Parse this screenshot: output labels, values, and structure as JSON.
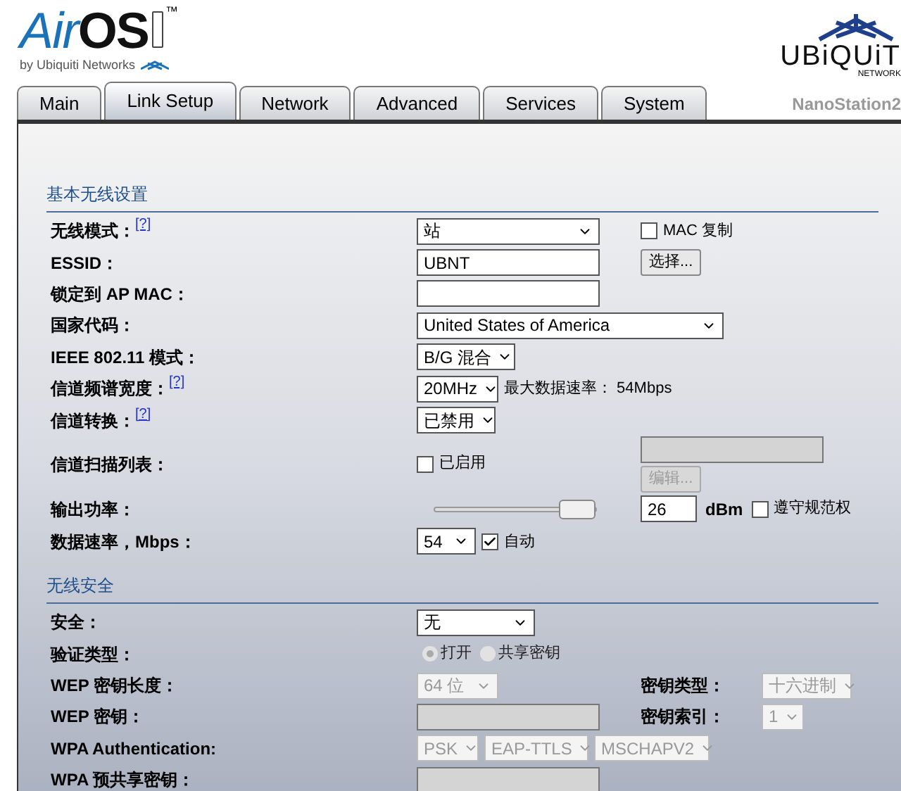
{
  "header": {
    "logo": {
      "air": "Air",
      "os": "OS",
      "tm": "™",
      "byline": "by Ubiquiti Networks"
    },
    "brand": {
      "name": "UBiQUiT",
      "sub": "NETWORK"
    },
    "device": "NanoStation2"
  },
  "tabs": [
    {
      "label": "Main",
      "selected": false
    },
    {
      "label": "Link Setup",
      "selected": true
    },
    {
      "label": "Network",
      "selected": false
    },
    {
      "label": "Advanced",
      "selected": false
    },
    {
      "label": "Services",
      "selected": false
    },
    {
      "label": "System",
      "selected": false
    }
  ],
  "sections": [
    {
      "title": "基本无线设置",
      "rows": [
        {
          "label": "无线模式：",
          "help": "[?]",
          "controls": [
            {
              "kind": "select",
              "value": "站",
              "disabled": false
            }
          ],
          "side": {
            "controls": [
              {
                "kind": "checkbox",
                "label": "MAC 复制",
                "checked": false,
                "disabled": false
              }
            ]
          }
        },
        {
          "label": "ESSID：",
          "controls": [
            {
              "kind": "text",
              "value": "UBNT",
              "disabled": false
            }
          ],
          "side": {
            "controls": [
              {
                "kind": "button",
                "label": "选择...",
                "disabled": false
              }
            ]
          }
        },
        {
          "label": "锁定到 AP MAC：",
          "controls": [
            {
              "kind": "text",
              "disabled": false
            }
          ]
        },
        {
          "label": "国家代码：",
          "controls": [
            {
              "kind": "select",
              "value": "United States of America",
              "disabled": false
            }
          ]
        },
        {
          "label": "IEEE 802.11 模式：",
          "controls": [
            {
              "kind": "select",
              "value": "B/G 混合",
              "disabled": false
            }
          ]
        },
        {
          "label": "信道频谱宽度：",
          "help": "[?]",
          "controls": [
            {
              "kind": "select",
              "value": "20MHz",
              "disabled": false
            },
            {
              "kind": "note",
              "text": "最大数据速率： 54Mbps"
            }
          ]
        },
        {
          "label": "信道转换：",
          "help": "[?]",
          "controls": [
            {
              "kind": "select",
              "value": "已禁用",
              "disabled": false
            }
          ]
        },
        {
          "label": "信道扫描列表：",
          "controls": [
            {
              "kind": "checkbox",
              "label": "已启用",
              "checked": false,
              "disabled": false
            }
          ],
          "side": {
            "controls": [
              {
                "kind": "stack",
                "items": [
                  {
                    "kind": "text",
                    "disabled": true
                  },
                  {
                    "kind": "button",
                    "label": "编辑...",
                    "disabled": true
                  }
                ]
              }
            ]
          }
        },
        {
          "label": "输出功率：",
          "controls": [
            {
              "kind": "slider",
              "level": 1
            }
          ],
          "side": {
            "controls": [
              {
                "kind": "text",
                "value": "26",
                "disabled": false
              },
              {
                "kind": "unit",
                "text": "dBm"
              },
              {
                "kind": "checkbox",
                "label": "遵守规范权",
                "checked": false,
                "disabled": false
              }
            ]
          }
        },
        {
          "label": "数据速率，Mbps：",
          "controls": [
            {
              "kind": "select",
              "value": "54",
              "disabled": false
            },
            {
              "kind": "checkbox",
              "label": "自动",
              "checked": true,
              "disabled": false
            }
          ]
        }
      ]
    },
    {
      "title": "无线安全",
      "rows": [
        {
          "label": "安全：",
          "controls": [
            {
              "kind": "select",
              "value": "无",
              "disabled": false
            }
          ]
        },
        {
          "label": "验证类型：",
          "controls": [
            {
              "kind": "radio",
              "disabled": true,
              "options": [
                {
                  "label": "打开",
                  "selected": true
                },
                {
                  "label": "共享密钥",
                  "selected": false
                }
              ]
            }
          ]
        },
        {
          "label": "WEP 密钥长度：",
          "controls": [
            {
              "kind": "select",
              "value": "64 位",
              "disabled": true
            }
          ],
          "side": {
            "label": "密钥类型：",
            "controls": [
              {
                "kind": "select",
                "value": "十六进制",
                "disabled": true
              }
            ]
          }
        },
        {
          "label": "WEP 密钥：",
          "controls": [
            {
              "kind": "text",
              "disabled": true
            }
          ],
          "side": {
            "label": "密钥索引：",
            "controls": [
              {
                "kind": "select",
                "value": "1",
                "disabled": true
              }
            ]
          }
        },
        {
          "label": "WPA Authentication:",
          "controls": [
            {
              "kind": "select",
              "value": "PSK",
              "disabled": true
            },
            {
              "kind": "select",
              "value": "EAP-TTLS",
              "disabled": true
            },
            {
              "kind": "select",
              "value": "MSCHAPV2",
              "disabled": true
            }
          ]
        },
        {
          "label": "WPA 预共享密钥：",
          "controls": [
            {
              "kind": "text",
              "disabled": true
            }
          ]
        }
      ]
    }
  ]
}
